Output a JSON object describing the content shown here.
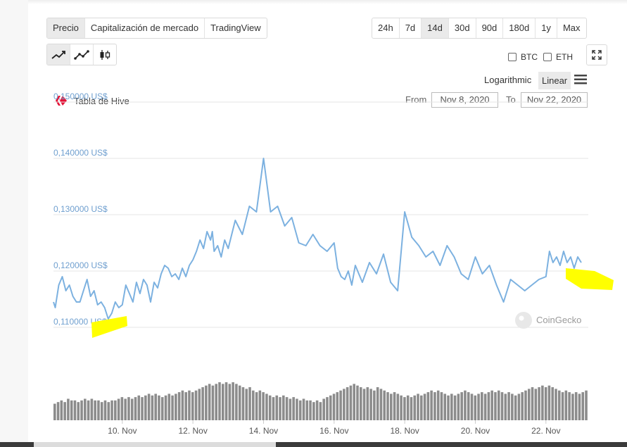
{
  "tabs": [
    {
      "label": "Precio",
      "active": true
    },
    {
      "label": "Capitalización de mercado",
      "active": false
    },
    {
      "label": "TradingView",
      "active": false
    }
  ],
  "ranges": [
    {
      "label": "24h",
      "active": false
    },
    {
      "label": "7d",
      "active": false
    },
    {
      "label": "14d",
      "active": true
    },
    {
      "label": "30d",
      "active": false
    },
    {
      "label": "90d",
      "active": false
    },
    {
      "label": "180d",
      "active": false
    },
    {
      "label": "1y",
      "active": false
    },
    {
      "label": "Max",
      "active": false
    }
  ],
  "chart_types": [
    {
      "icon": "line-chart-icon",
      "active": true
    },
    {
      "icon": "point-line-chart-icon",
      "active": false
    },
    {
      "icon": "candlestick-icon",
      "active": false
    }
  ],
  "compare": {
    "btc": "BTC",
    "eth": "ETH"
  },
  "scale": {
    "log": "Logarithmic",
    "linear": "Linear"
  },
  "title": "Tabla de Hive",
  "from_label": "From",
  "to_label": "To",
  "from_date": "Nov 8, 2020",
  "to_date": "Nov 22, 2020",
  "watermark": "CoinGecko",
  "colors": {
    "line": "#7cb1e0",
    "volume": "#8c8c8c",
    "grid": "#e6e6e6",
    "axis_label": "#6f9fcf",
    "highlight": "#ffff00",
    "hive_logo": "#e31337"
  },
  "chart_data": {
    "type": "line",
    "title": "Tabla de Hive",
    "y_tick_labels": [
      "0,150000 US$",
      "0,140000 US$",
      "0,130000 US$",
      "0,120000 US$",
      "0,110000 US$"
    ],
    "y_ticks": [
      0.15,
      0.14,
      0.13,
      0.12,
      0.11
    ],
    "ylim": [
      0.105,
      0.15
    ],
    "x_tick_labels": [
      "10. Nov",
      "12. Nov",
      "14. Nov",
      "16. Nov",
      "18. Nov",
      "20. Nov",
      "22. Nov"
    ],
    "x_ticks": [
      10,
      12,
      14,
      16,
      18,
      20,
      22
    ],
    "xlim": [
      8.05,
      23.2
    ],
    "grid": true,
    "series": [
      {
        "x": [
          8.05,
          8.1,
          8.2,
          8.3,
          8.4,
          8.5,
          8.6,
          8.7,
          8.8,
          8.9,
          9.0,
          9.1,
          9.2,
          9.3,
          9.4,
          9.5,
          9.6,
          9.7,
          9.8,
          9.9,
          10.0,
          10.1,
          10.2,
          10.3,
          10.4,
          10.5,
          10.6,
          10.7,
          10.8,
          10.9,
          11.0,
          11.1,
          11.2,
          11.3,
          11.4,
          11.5,
          11.6,
          11.7,
          11.8,
          11.9,
          12.0,
          12.1,
          12.2,
          12.3,
          12.4,
          12.5,
          12.55,
          12.6,
          12.7,
          12.8,
          12.9,
          13.0,
          13.2,
          13.4,
          13.6,
          13.8,
          14.0,
          14.2,
          14.4,
          14.6,
          14.8,
          15.0,
          15.2,
          15.4,
          15.6,
          15.8,
          16.0,
          16.1,
          16.2,
          16.3,
          16.4,
          16.5,
          16.6,
          16.7,
          16.8,
          17.0,
          17.2,
          17.4,
          17.6,
          17.8,
          18.0,
          18.2,
          18.4,
          18.6,
          18.8,
          19.0,
          19.2,
          19.4,
          19.6,
          19.8,
          20.0,
          20.2,
          20.4,
          20.6,
          20.8,
          21.0,
          21.2,
          21.4,
          21.6,
          21.8,
          22.0,
          22.1,
          22.2,
          22.3,
          22.4,
          22.5,
          22.6,
          22.7,
          22.8,
          22.9,
          23.0
        ],
        "y": [
          0.1145,
          0.1135,
          0.1175,
          0.119,
          0.1165,
          0.1175,
          0.1155,
          0.1145,
          0.1145,
          0.1165,
          0.1185,
          0.1155,
          0.1165,
          0.114,
          0.1145,
          0.1135,
          0.1115,
          0.1125,
          0.1145,
          0.1135,
          0.114,
          0.1175,
          0.116,
          0.1145,
          0.118,
          0.116,
          0.1185,
          0.1175,
          0.1145,
          0.118,
          0.117,
          0.1195,
          0.121,
          0.1205,
          0.119,
          0.1195,
          0.1185,
          0.1205,
          0.119,
          0.121,
          0.122,
          0.1235,
          0.1255,
          0.124,
          0.127,
          0.1255,
          0.127,
          0.1235,
          0.1245,
          0.1225,
          0.1255,
          0.124,
          0.129,
          0.1265,
          0.1315,
          0.1305,
          0.14,
          0.1305,
          0.1315,
          0.128,
          0.1295,
          0.125,
          0.1245,
          0.1265,
          0.1245,
          0.1235,
          0.125,
          0.1205,
          0.119,
          0.1185,
          0.12,
          0.1175,
          0.121,
          0.1195,
          0.118,
          0.1215,
          0.1195,
          0.123,
          0.118,
          0.1165,
          0.1305,
          0.126,
          0.1245,
          0.1225,
          0.1235,
          0.121,
          0.1245,
          0.1225,
          0.1195,
          0.1185,
          0.1225,
          0.1195,
          0.121,
          0.1175,
          0.1145,
          0.1185,
          0.1175,
          0.1165,
          0.1175,
          0.1185,
          0.119,
          0.1235,
          0.1215,
          0.1225,
          0.121,
          0.1235,
          0.1215,
          0.1225,
          0.1205,
          0.1225,
          0.1215
        ]
      }
    ],
    "volume": [
      10,
      11,
      12,
      11,
      13,
      12,
      12,
      11,
      12,
      13,
      12,
      13,
      12,
      12,
      11,
      12,
      11,
      12,
      12,
      13,
      14,
      13,
      14,
      13,
      14,
      15,
      14,
      15,
      16,
      15,
      16,
      15,
      14,
      15,
      16,
      15,
      16,
      17,
      18,
      17,
      18,
      17,
      18,
      19,
      20,
      21,
      22,
      21,
      22,
      23,
      22,
      23,
      22,
      23,
      22,
      21,
      20,
      19,
      20,
      18,
      17,
      18,
      17,
      16,
      15,
      14,
      15,
      14,
      15,
      14,
      13,
      14,
      13,
      12,
      13,
      12,
      12,
      11,
      12,
      11,
      13,
      14,
      15,
      16,
      17,
      18,
      19,
      20,
      21,
      22,
      21,
      20,
      19,
      20,
      19,
      18,
      20,
      19,
      18,
      17,
      16,
      17,
      16,
      15,
      14,
      15,
      14,
      15,
      16,
      15,
      16,
      17,
      18,
      17,
      18,
      17,
      16,
      15,
      16,
      15,
      16,
      17,
      18,
      17,
      16,
      15,
      16,
      17,
      16,
      17,
      18,
      17,
      18,
      17,
      16,
      17,
      16,
      15,
      16,
      17,
      18,
      19,
      20,
      19,
      20,
      21,
      20,
      21,
      20,
      19,
      18,
      17,
      18,
      17,
      16,
      17,
      16,
      17,
      18
    ]
  }
}
